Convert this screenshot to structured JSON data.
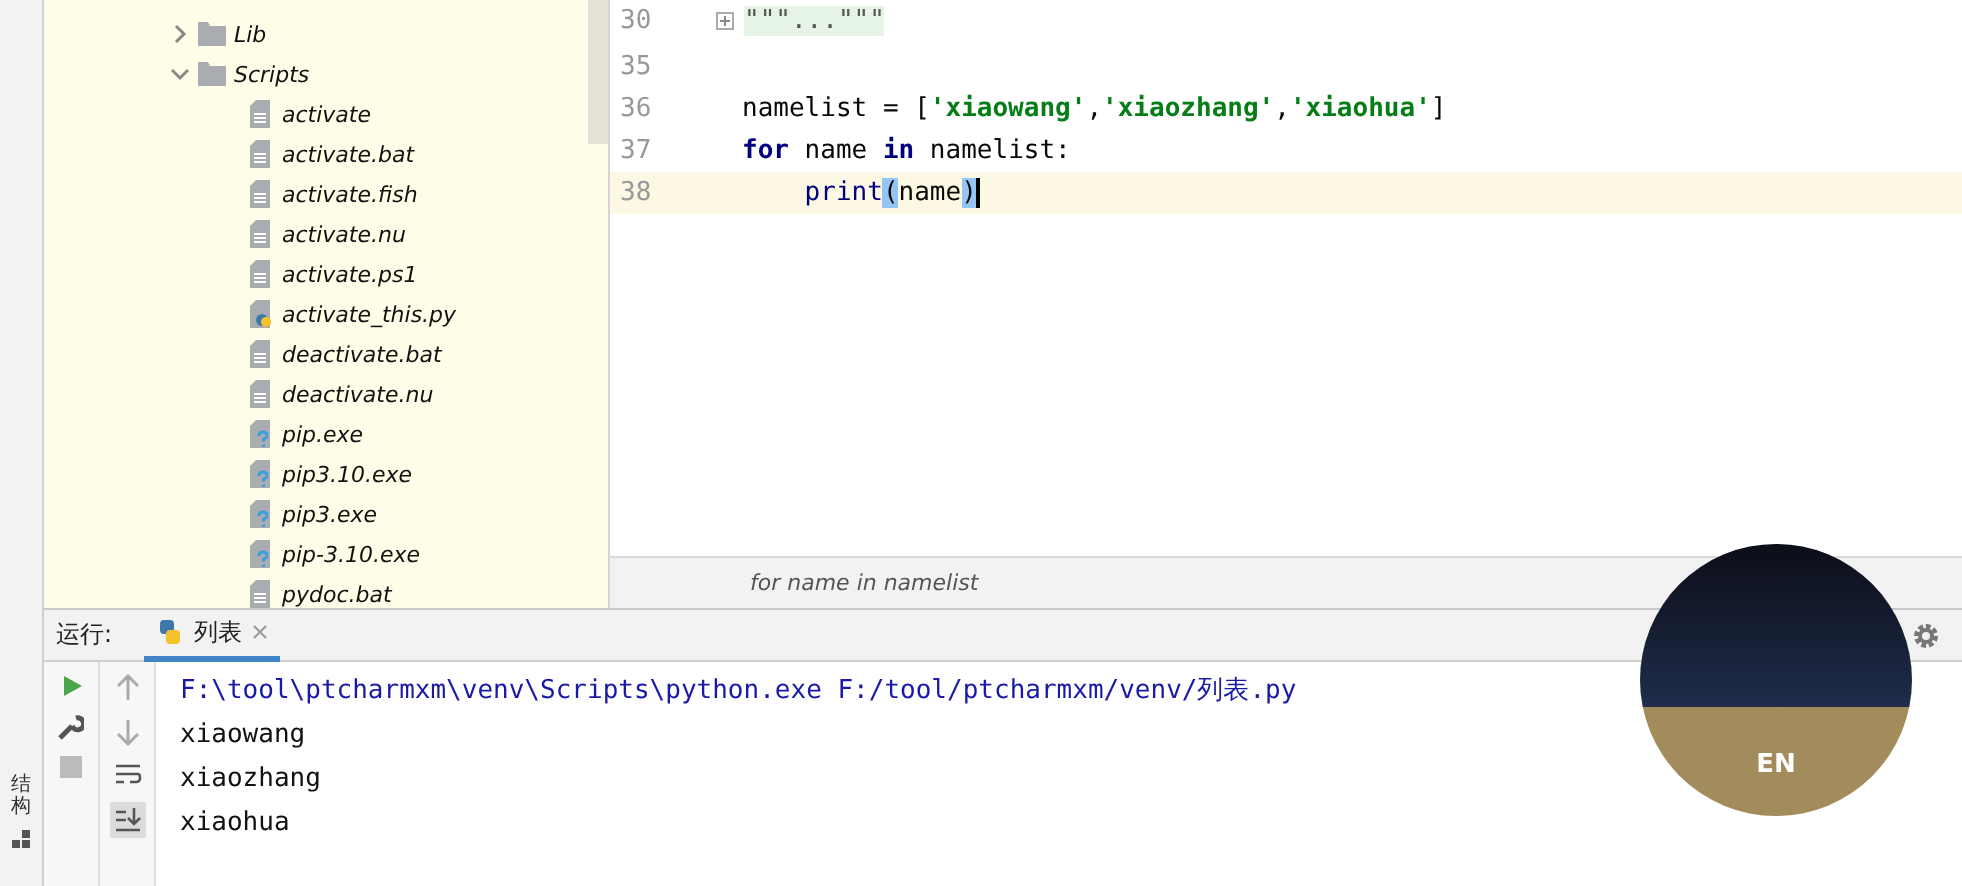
{
  "project_tree": {
    "items": [
      {
        "label": "Lib",
        "kind": "folder",
        "expanded": false
      },
      {
        "label": "Scripts",
        "kind": "folder",
        "expanded": true,
        "children": [
          {
            "label": "activate",
            "kind": "text"
          },
          {
            "label": "activate.bat",
            "kind": "text"
          },
          {
            "label": "activate.fish",
            "kind": "text"
          },
          {
            "label": "activate.nu",
            "kind": "text"
          },
          {
            "label": "activate.ps1",
            "kind": "text"
          },
          {
            "label": "activate_this.py",
            "kind": "python"
          },
          {
            "label": "deactivate.bat",
            "kind": "text"
          },
          {
            "label": "deactivate.nu",
            "kind": "text"
          },
          {
            "label": "pip.exe",
            "kind": "unknown"
          },
          {
            "label": "pip3.10.exe",
            "kind": "unknown"
          },
          {
            "label": "pip3.exe",
            "kind": "unknown"
          },
          {
            "label": "pip-3.10.exe",
            "kind": "unknown"
          },
          {
            "label": "pydoc.bat",
            "kind": "text"
          }
        ]
      }
    ]
  },
  "editor": {
    "lines": [
      {
        "number": "30",
        "kind": "folded",
        "tokens": [
          {
            "text": "\"\"\"...\"\"\"",
            "kind": "fold"
          }
        ],
        "current": false
      },
      {
        "number": "35",
        "kind": "code",
        "current": false
      },
      {
        "number": "36",
        "kind": "code",
        "tokens": [
          {
            "text": "namelist = [",
            "kind": "plain"
          },
          {
            "text": "'xiaowang'",
            "kind": "string"
          },
          {
            "text": ",",
            "kind": "plain"
          },
          {
            "text": "'xiaozhang'",
            "kind": "string"
          },
          {
            "text": ",",
            "kind": "plain"
          },
          {
            "text": "'xiaohua'",
            "kind": "string"
          },
          {
            "text": "]",
            "kind": "plain"
          }
        ],
        "current": false
      },
      {
        "number": "37",
        "kind": "code",
        "tokens": [
          {
            "text": "for",
            "kind": "keyword"
          },
          {
            "text": " name ",
            "kind": "plain"
          },
          {
            "text": "in",
            "kind": "keyword"
          },
          {
            "text": " namelist:",
            "kind": "plain"
          }
        ],
        "current": false
      },
      {
        "number": "38",
        "kind": "code",
        "tokens": [
          {
            "text": "    print",
            "kind": "builtin"
          },
          {
            "text": "(",
            "kind": "brace"
          },
          {
            "text": "name",
            "kind": "plain"
          },
          {
            "text": ")",
            "kind": "brace"
          }
        ],
        "current": true
      }
    ],
    "breadcrumb": "for name in namelist"
  },
  "run_panel": {
    "label": "运行:",
    "tabs": [
      {
        "label": "列表",
        "selected": true
      }
    ],
    "output": [
      {
        "text": "F:\\tool\\ptcharmxm\\venv\\Scripts\\python.exe F:/tool/ptcharmxm/venv/列表.py",
        "kind": "command"
      },
      {
        "text": "xiaowang",
        "kind": "stdout"
      },
      {
        "text": "xiaozhang",
        "kind": "stdout"
      },
      {
        "text": "xiaohua",
        "kind": "stdout"
      }
    ]
  },
  "side_strip": {
    "label": "结构"
  },
  "ime_widget": {
    "label": "EN"
  }
}
